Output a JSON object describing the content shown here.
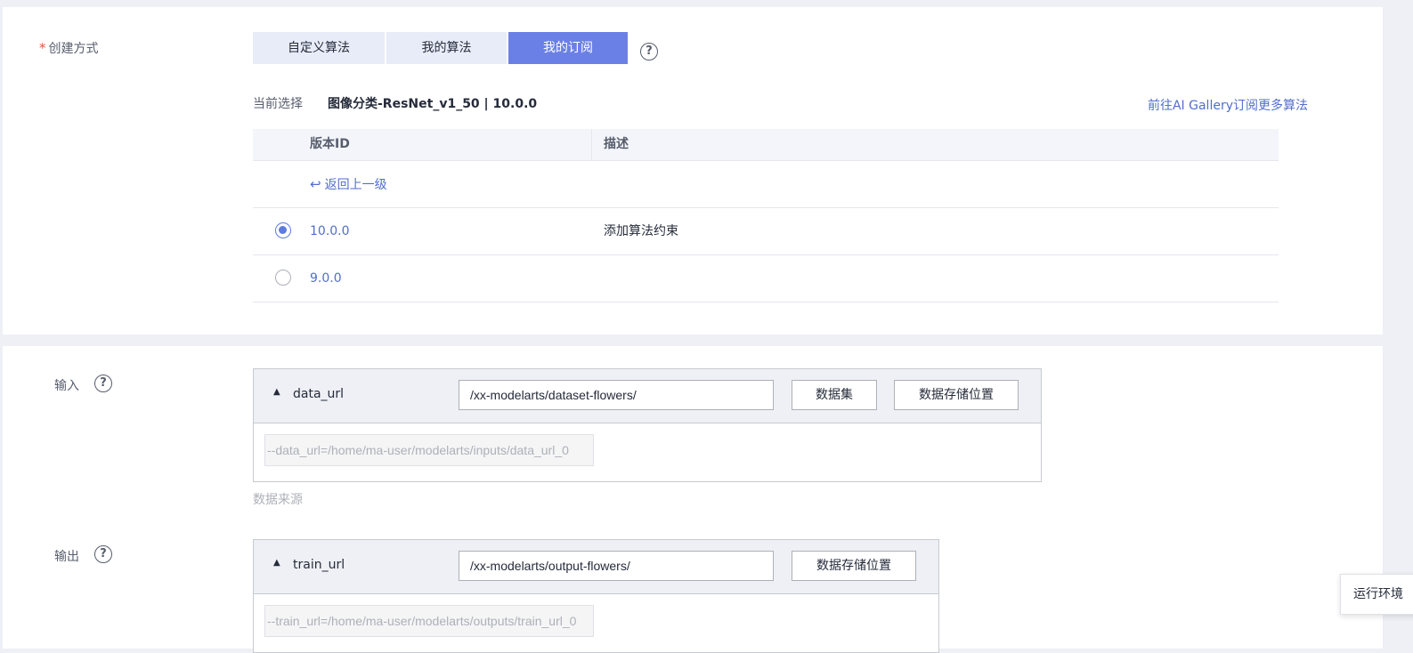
{
  "create_method": {
    "label": "创建方式",
    "required_mark": "*",
    "tabs": [
      {
        "label": "自定义算法",
        "active": false
      },
      {
        "label": "我的算法",
        "active": false
      },
      {
        "label": "我的订阅",
        "active": true
      }
    ],
    "help": "?"
  },
  "current_selection": {
    "label": "当前选择",
    "value": "图像分类-ResNet_v1_50 | 10.0.0"
  },
  "gallery_link": "前往AI Gallery订阅更多算法",
  "version_table": {
    "headers": [
      "版本ID",
      "描述"
    ],
    "back_label": "返回上一级",
    "rows": [
      {
        "version": "10.0.0",
        "description": "添加算法约束",
        "selected": true
      },
      {
        "version": "9.0.0",
        "description": "",
        "selected": false
      }
    ]
  },
  "input": {
    "label": "输入",
    "param_name": "data_url",
    "path": "/xx-modelarts/dataset-flowers/",
    "dataset_button": "数据集",
    "storage_button": "数据存储位置",
    "arg": "--data_url=/home/ma-user/modelarts/inputs/data_url_0",
    "hint": "数据来源"
  },
  "output": {
    "label": "输出",
    "param_name": "train_url",
    "path": "/xx-modelarts/output-flowers/",
    "storage_button": "数据存储位置",
    "arg": "--train_url=/home/ma-user/modelarts/outputs/train_url_0"
  },
  "floating_tab": "运行环境",
  "colors": {
    "accent": "#6b80e6",
    "link": "#526ecc",
    "required": "#e8543d"
  }
}
